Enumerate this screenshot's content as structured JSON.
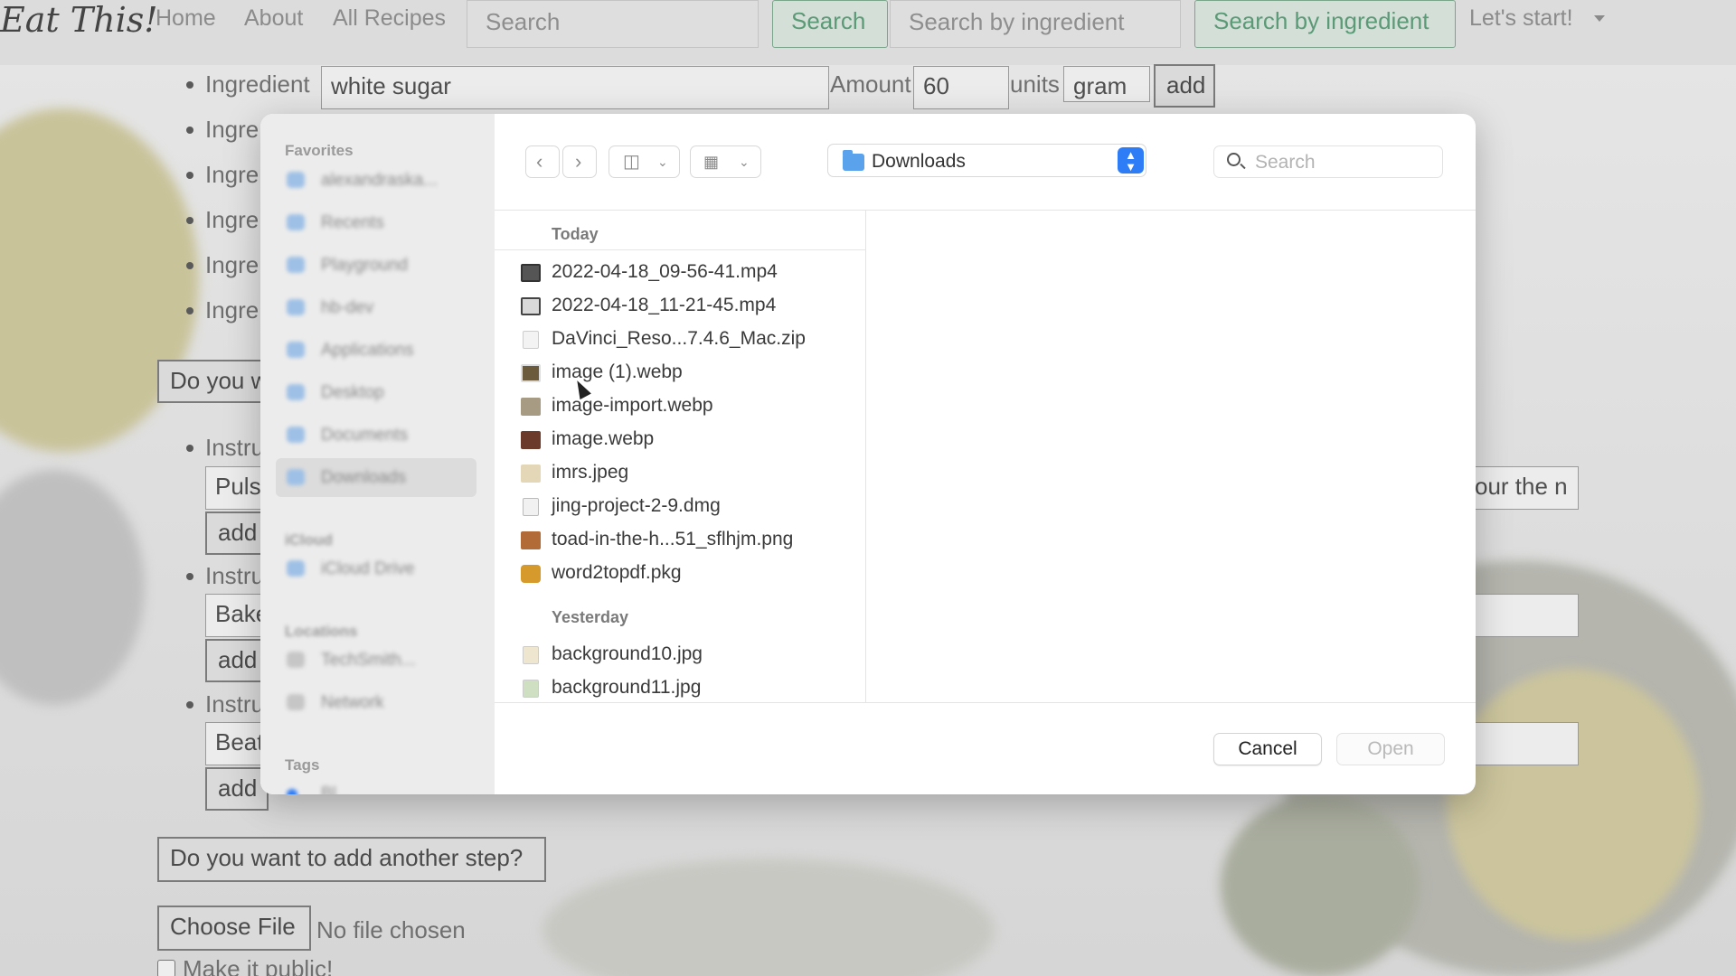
{
  "background_page": {
    "brand": "Eat This!",
    "nav": {
      "home": "Home",
      "about": "About",
      "all_recipes": "All Recipes",
      "search_placeholder": "Search",
      "search_button": "Search",
      "ingredient_placeholder": "Search by ingredient",
      "ingredient_button": "Search by ingredient",
      "start_menu": "Let's start!"
    },
    "ingredient_row": {
      "label": "Ingredient",
      "value": "white sugar",
      "amount_label": "Amount",
      "amount_value": "60",
      "units_label": "units",
      "unit_value": "gram",
      "add_button": "add"
    },
    "partial_ingredient_label": "Ingre",
    "partial_question": "Do you w",
    "partial_instruction_label": "Instru",
    "instructions": [
      {
        "value": "Puls",
        "right_fragment": "our the n"
      },
      {
        "value": "Bake"
      },
      {
        "value": "Beat"
      }
    ],
    "add_button": "add",
    "add_step_button": "Do you want to add another step?",
    "choose_file_button": "Choose File",
    "no_file_text": "No file chosen",
    "public_checkbox_label": "Make it public!"
  },
  "dialog": {
    "sidebar": {
      "favorites_heading": "Favorites",
      "icloud_heading": "iCloud",
      "locations_heading": "Locations",
      "tags_heading": "Tags",
      "favorites": [
        "alexandraska...",
        "Recents",
        "Playground",
        "hb-dev",
        "Applications",
        "Desktop",
        "Documents",
        "Downloads"
      ],
      "icloud": [
        "iCloud Drive"
      ],
      "locations": [
        "TechSmith...",
        "Network"
      ],
      "tags": [
        "Bl..."
      ]
    },
    "location": "Downloads",
    "search_placeholder": "Search",
    "sections": [
      {
        "title": "Today",
        "files": [
          {
            "name": "2022-04-18_09-56-41.mp4",
            "icon": "video-file-icon"
          },
          {
            "name": "2022-04-18_11-21-45.mp4",
            "icon": "video-file-icon"
          },
          {
            "name": "DaVinci_Reso...7.4.6_Mac.zip",
            "icon": "zip-file-icon"
          },
          {
            "name": "image (1).webp",
            "icon": "image-file-icon"
          },
          {
            "name": "image-import.webp",
            "icon": "image-file-icon"
          },
          {
            "name": "image.webp",
            "icon": "image-file-icon"
          },
          {
            "name": "imrs.jpeg",
            "icon": "image-file-icon"
          },
          {
            "name": "jing-project-2-9.dmg",
            "icon": "disk-image-icon"
          },
          {
            "name": "toad-in-the-h...51_sflhjm.png",
            "icon": "image-file-icon"
          },
          {
            "name": "word2topdf.pkg",
            "icon": "package-icon"
          }
        ]
      },
      {
        "title": "Yesterday",
        "files": [
          {
            "name": "background10.jpg",
            "icon": "image-file-icon"
          },
          {
            "name": "background11.jpg",
            "icon": "image-file-icon"
          }
        ]
      }
    ],
    "cancel_button": "Cancel",
    "open_button": "Open",
    "colors": {
      "accent": "#2f7df6",
      "folder": "#5aa3ec"
    }
  }
}
